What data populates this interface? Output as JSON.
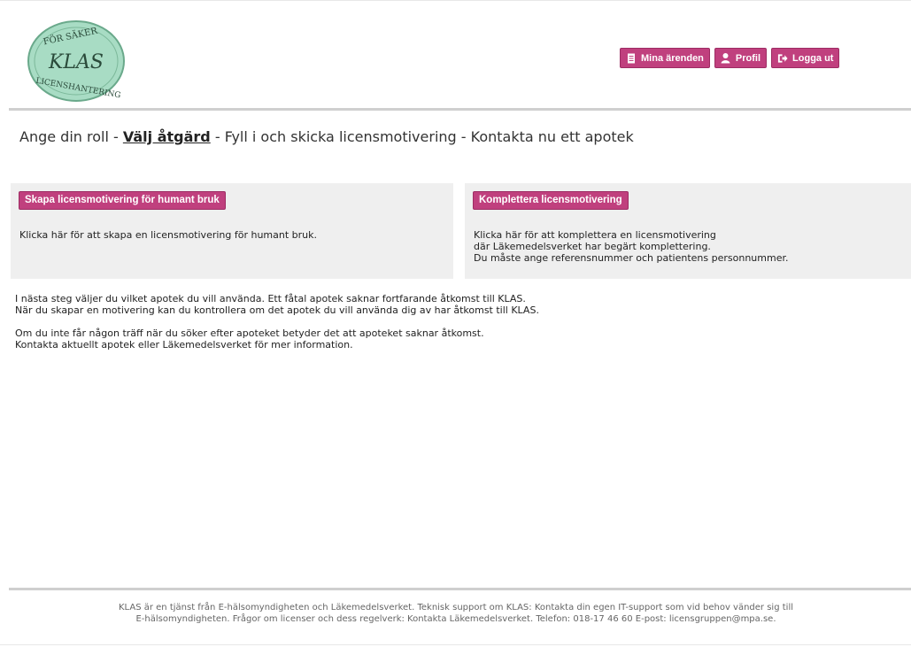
{
  "header": {
    "logo": {
      "top_text": "FÖR SÄKER",
      "main_text": "KLAS",
      "bottom_text": "LICENSHANTERING"
    },
    "actions": [
      {
        "label": "Mina ärenden",
        "icon": "document-icon"
      },
      {
        "label": "Profil",
        "icon": "user-icon"
      },
      {
        "label": "Logga ut",
        "icon": "logout-icon"
      }
    ]
  },
  "steps": {
    "step1": "Ange din roll",
    "separator": " - ",
    "step2": "Välj åtgärd",
    "step3": "Fyll i och skicka licensmotivering",
    "step4": "Kontakta nu ett apotek"
  },
  "panels": {
    "create": {
      "title": "Skapa licensmotivering för humant bruk",
      "text": "Klicka här för att skapa en licensmotivering för humant bruk."
    },
    "complete": {
      "title": "Komplettera licensmotivering",
      "line1": "Klicka här för att komplettera en licensmotivering",
      "line2": "där Läkemedelsverket har begärt komplettering.",
      "line3": "Du måste ange referensnummer och patientens personnummer."
    }
  },
  "info": {
    "p1_line1": "I nästa steg väljer du vilket apotek du vill använda. Ett fåtal apotek saknar fortfarande åtkomst till KLAS.",
    "p1_line2": "När du skapar en motivering kan du kontrollera om det apotek du vill använda dig av har åtkomst till KLAS.",
    "p2_line1": "Om du inte får någon träff när du söker efter apoteket betyder det att apoteket saknar åtkomst.",
    "p2_line2": "Kontakta aktuellt apotek eller Läkemedelsverket för mer information."
  },
  "footer": {
    "line1": "KLAS är en tjänst från E-hälsomyndigheten och Läkemedelsverket. Teknisk support om KLAS: Kontakta din egen IT-support som vid behov vänder sig till",
    "line2": "E-hälsomyndigheten. Frågor om licenser och dess regelverk: Kontakta Läkemedelsverket. Telefon: 018-17 46 60 E-post: licensgruppen@mpa.se."
  },
  "colors": {
    "accent": "#c0407e",
    "logo_fill": "#a8dcc4",
    "panel_bg": "#efefef"
  }
}
